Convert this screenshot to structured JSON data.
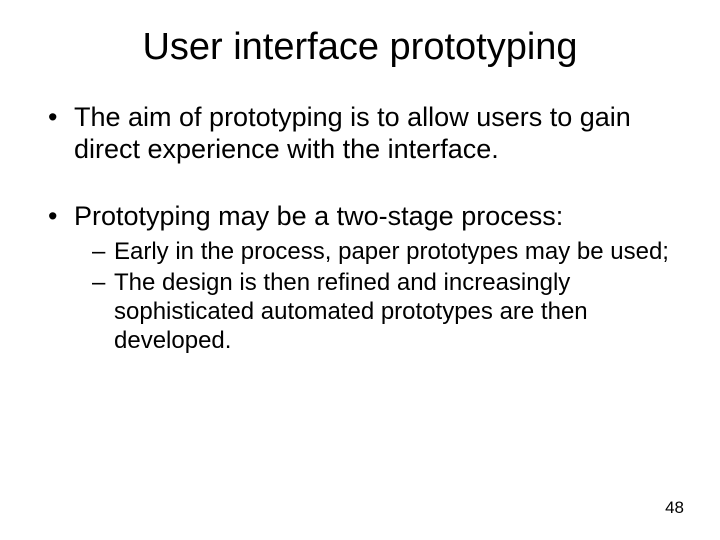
{
  "title": "User interface prototyping",
  "bullets": [
    {
      "text": "The aim of prototyping is to allow users to gain direct experience with the interface."
    },
    {
      "text": "Prototyping may be a two-stage process:",
      "sub": [
        "Early in the process, paper prototypes may be used;",
        "The design is then refined and increasingly sophisticated automated prototypes are then developed."
      ]
    }
  ],
  "page_number": "48"
}
